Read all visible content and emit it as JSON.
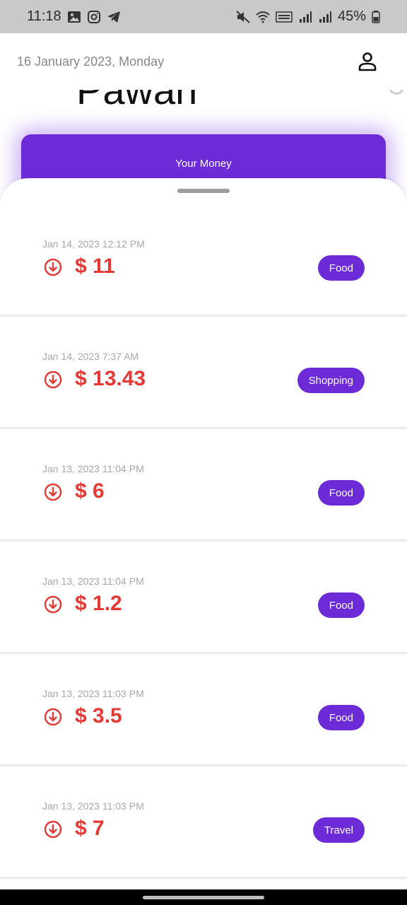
{
  "status_bar": {
    "time": "11:18",
    "battery": "45%",
    "left_icons": [
      "image-icon",
      "instagram-icon",
      "telegram-icon"
    ],
    "right_icons": [
      "mute-icon",
      "wifi-icon",
      "volte-icon",
      "signal-icon",
      "signal-2-icon",
      "battery-icon"
    ]
  },
  "header": {
    "date": "16 January 2023, Monday",
    "profile_icon": "person-icon"
  },
  "user": {
    "name": "Pawan"
  },
  "card": {
    "label": "Your Money",
    "color": "#6d2bd8"
  },
  "colors": {
    "accent": "#6d2bd8",
    "expense": "#e53935"
  },
  "transactions": [
    {
      "date": "Jan 14, 2023 12:12 PM",
      "amount": "$ 11",
      "category": "Food",
      "icon": "arrow-down-circle-icon"
    },
    {
      "date": "Jan 14, 2023 7:37 AM",
      "amount": "$ 13.43",
      "category": "Shopping",
      "icon": "arrow-down-circle-icon"
    },
    {
      "date": "Jan 13, 2023 11:04 PM",
      "amount": "$ 6",
      "category": "Food",
      "icon": "arrow-down-circle-icon"
    },
    {
      "date": "Jan 13, 2023 11:04 PM",
      "amount": "$ 1.2",
      "category": "Food",
      "icon": "arrow-down-circle-icon"
    },
    {
      "date": "Jan 13, 2023 11:03 PM",
      "amount": "$ 3.5",
      "category": "Food",
      "icon": "arrow-down-circle-icon"
    },
    {
      "date": "Jan 13, 2023 11:03 PM",
      "amount": "$ 7",
      "category": "Travel",
      "icon": "arrow-down-circle-icon"
    }
  ]
}
